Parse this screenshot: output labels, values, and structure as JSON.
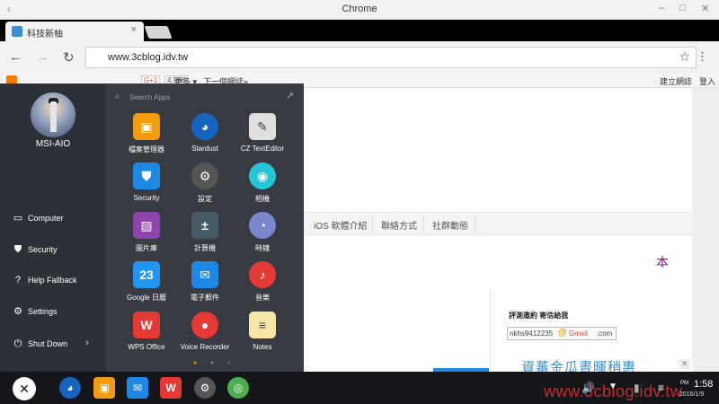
{
  "window": {
    "title": "Chrome",
    "back_glyph": "‹",
    "min_glyph": "–",
    "max_glyph": "□",
    "close_glyph": "✕"
  },
  "tab": {
    "title": "科技新柚",
    "close": "×"
  },
  "toolbar": {
    "back": "←",
    "forward": "→",
    "reload": "↻",
    "url": "www.3cblog.idv.tw",
    "star": "☆",
    "menu": "⋮"
  },
  "bookmarks": {
    "gplus": "G+1",
    "count": "4,968",
    "more": "更多 ▾",
    "next": "下一個網誌»",
    "create": "建立網誌",
    "login": "登入"
  },
  "page": {
    "nav": [
      "iOS 軟體介紹",
      "聯絡方式",
      "社群動態"
    ],
    "char": "本",
    "review": "評測邀約 寄信給我",
    "email_user": "nkhs9412235",
    "email_at": "@",
    "email_domain": "Gmail",
    "email_tld": ".com",
    "watermark": "資蕃金瓜晝暉稍惠",
    "ad_close": "✕"
  },
  "startmenu": {
    "user": "MSI-AIO",
    "search_placeholder": "Search Apps",
    "search_icon": "⌕",
    "expand_icon": "↗",
    "items": [
      {
        "label": "Computer",
        "icon": "monitor-icon",
        "glyph": "▭"
      },
      {
        "label": "Security",
        "icon": "shield-icon",
        "glyph": "⛊"
      },
      {
        "label": "Help Fallback",
        "icon": "help-icon",
        "glyph": "?"
      },
      {
        "label": "Settings",
        "icon": "gear-icon",
        "glyph": "⚙"
      },
      {
        "label": "Shut Down",
        "icon": "power-icon",
        "glyph": "⏻",
        "arrow": "›"
      }
    ],
    "apps": [
      {
        "label": "檔案管理器",
        "color": "#f39c12",
        "glyph": "▣",
        "name": "file-manager-icon"
      },
      {
        "label": "Stardust",
        "color": "#1565c0",
        "glyph": "◕",
        "name": "stardust-icon",
        "round": true
      },
      {
        "label": "CZ TextEditor",
        "color": "#e0e0e0",
        "glyph": "✎",
        "name": "text-editor-icon"
      },
      {
        "label": "Security",
        "color": "#1e88e5",
        "glyph": "⛊",
        "name": "security-app-icon"
      },
      {
        "label": "設定",
        "color": "#555555",
        "glyph": "⚙",
        "name": "settings-app-icon",
        "round": true
      },
      {
        "label": "相機",
        "color": "#26c6da",
        "glyph": "◉",
        "name": "camera-icon",
        "round": true
      },
      {
        "label": "圖片庫",
        "color": "#8e44ad",
        "glyph": "▨",
        "name": "gallery-icon"
      },
      {
        "label": "計算機",
        "color": "#455a64",
        "glyph": "±",
        "name": "calculator-icon"
      },
      {
        "label": "時鐘",
        "color": "#7986cb",
        "glyph": "◔",
        "name": "clock-icon",
        "round": true
      },
      {
        "label": "Google 日曆",
        "color": "#2196f3",
        "glyph": "23",
        "name": "calendar-icon"
      },
      {
        "label": "電子郵件",
        "color": "#1e88e5",
        "glyph": "✉",
        "name": "email-app-icon"
      },
      {
        "label": "音樂",
        "color": "#e53935",
        "glyph": "♪",
        "name": "music-icon",
        "round": true
      },
      {
        "label": "WPS Office",
        "color": "#e53935",
        "glyph": "W",
        "name": "wps-office-icon"
      },
      {
        "label": "Voice Recorder",
        "color": "#e53935",
        "glyph": "●",
        "name": "voice-recorder-icon",
        "round": true
      },
      {
        "label": "Notes",
        "color": "#f5e6a8",
        "glyph": "≡",
        "name": "notes-icon"
      }
    ],
    "pager": [
      "●",
      "●",
      "›"
    ]
  },
  "taskbar": {
    "start_glyph": "✕",
    "apps": [
      {
        "name": "taskbar-stardust-icon",
        "color": "#1565c0",
        "glyph": "◕",
        "round": true
      },
      {
        "name": "taskbar-file-manager-icon",
        "color": "#f39c12",
        "glyph": "▣"
      },
      {
        "name": "taskbar-email-icon",
        "color": "#1e88e5",
        "glyph": "✉"
      },
      {
        "name": "taskbar-wps-icon",
        "color": "#e53935",
        "glyph": "W"
      },
      {
        "name": "taskbar-settings-icon",
        "color": "#555555",
        "glyph": "⚙",
        "round": true
      },
      {
        "name": "taskbar-chrome-icon",
        "color": "#4caf50",
        "glyph": "◎",
        "round": true
      }
    ],
    "volume": "🔊",
    "wifi": "▼",
    "battery": "▮",
    "notifications": "≡",
    "ampm": "PM",
    "time": "1:58",
    "date": "2016/1/9",
    "watermark": "www.3cblog.idv.tw"
  }
}
